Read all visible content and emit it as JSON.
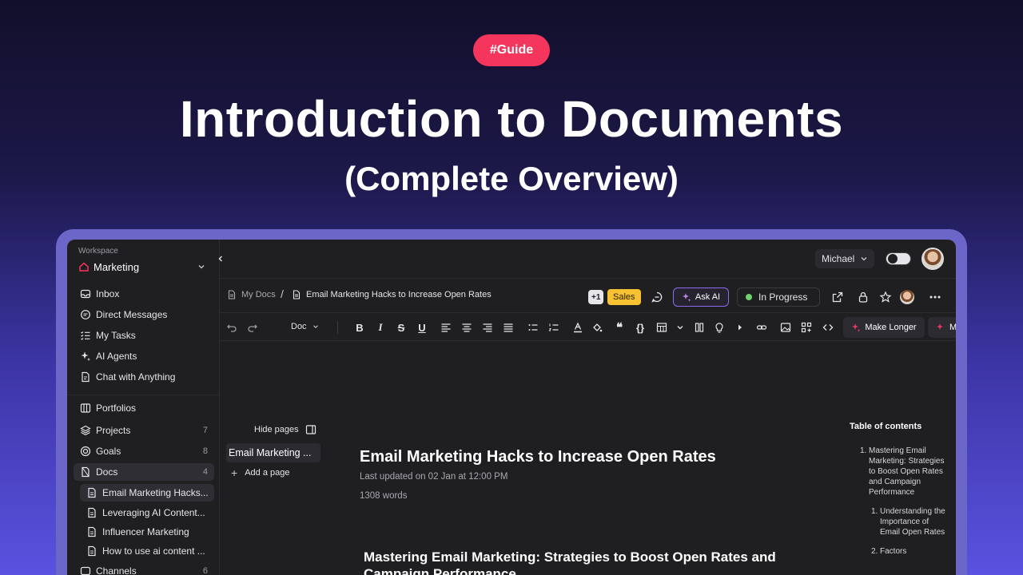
{
  "hero": {
    "tag": "#Guide",
    "title": "Introduction to Documents",
    "subtitle": "(Complete Overview)"
  },
  "sidebar": {
    "workspace_label": "Workspace",
    "workspace_name": "Marketing",
    "items": [
      {
        "label": "Inbox",
        "icon": "inbox-icon"
      },
      {
        "label": "Direct Messages",
        "icon": "message-icon"
      },
      {
        "label": "My Tasks",
        "icon": "tasks-icon"
      },
      {
        "label": "AI Agents",
        "icon": "sparkle-icon"
      },
      {
        "label": "Chat with Anything",
        "icon": "chat-doc-icon"
      }
    ],
    "sections": [
      {
        "label": "Portfolios",
        "count": ""
      },
      {
        "label": "Projects",
        "count": "7"
      },
      {
        "label": "Goals",
        "count": "8"
      },
      {
        "label": "Docs",
        "count": "4"
      },
      {
        "label": "Channels",
        "count": "6"
      }
    ],
    "docs": [
      "Email Marketing Hacks...",
      "Leveraging AI Content...",
      "Influencer Marketing",
      "How to use ai content ..."
    ]
  },
  "topbar": {
    "user_name": "Michael"
  },
  "breadcrumb": {
    "root": "My Docs",
    "separator": "/",
    "current": "Email Marketing Hacks to Increase Open Rates",
    "plus_badge": "+1",
    "tag": "Sales",
    "ask_ai": "Ask AI",
    "status": "In Progress"
  },
  "toolbar": {
    "doc_type": "Doc",
    "make_longer": "Make Longer",
    "make_more": "M"
  },
  "pages": {
    "hide_label": "Hide pages",
    "current_page": "Email Marketing ...",
    "add_label": "Add a page"
  },
  "document": {
    "title": "Email Marketing Hacks to Increase Open Rates",
    "updated": "Last updated on 02 Jan at 12:00 PM",
    "words": "1308 words",
    "heading": "Mastering Email Marketing: Strategies to Boost Open Rates and Campaign Performance"
  },
  "toc": {
    "title": "Table of contents",
    "items": [
      {
        "num": "1.",
        "text": "Mastering Email Marketing: Strategies to Boost Open Rates and Campaign Performance"
      },
      {
        "num": "1.",
        "text": "Understanding the Importance of Email Open Rates"
      },
      {
        "num": "2.",
        "text": "Factors"
      }
    ]
  },
  "colors": {
    "guide_pill": "#f5365c",
    "status_dot": "#6fd16f",
    "sales_badge": "#f6c233",
    "ask_ai_border": "#8b6cf0"
  }
}
